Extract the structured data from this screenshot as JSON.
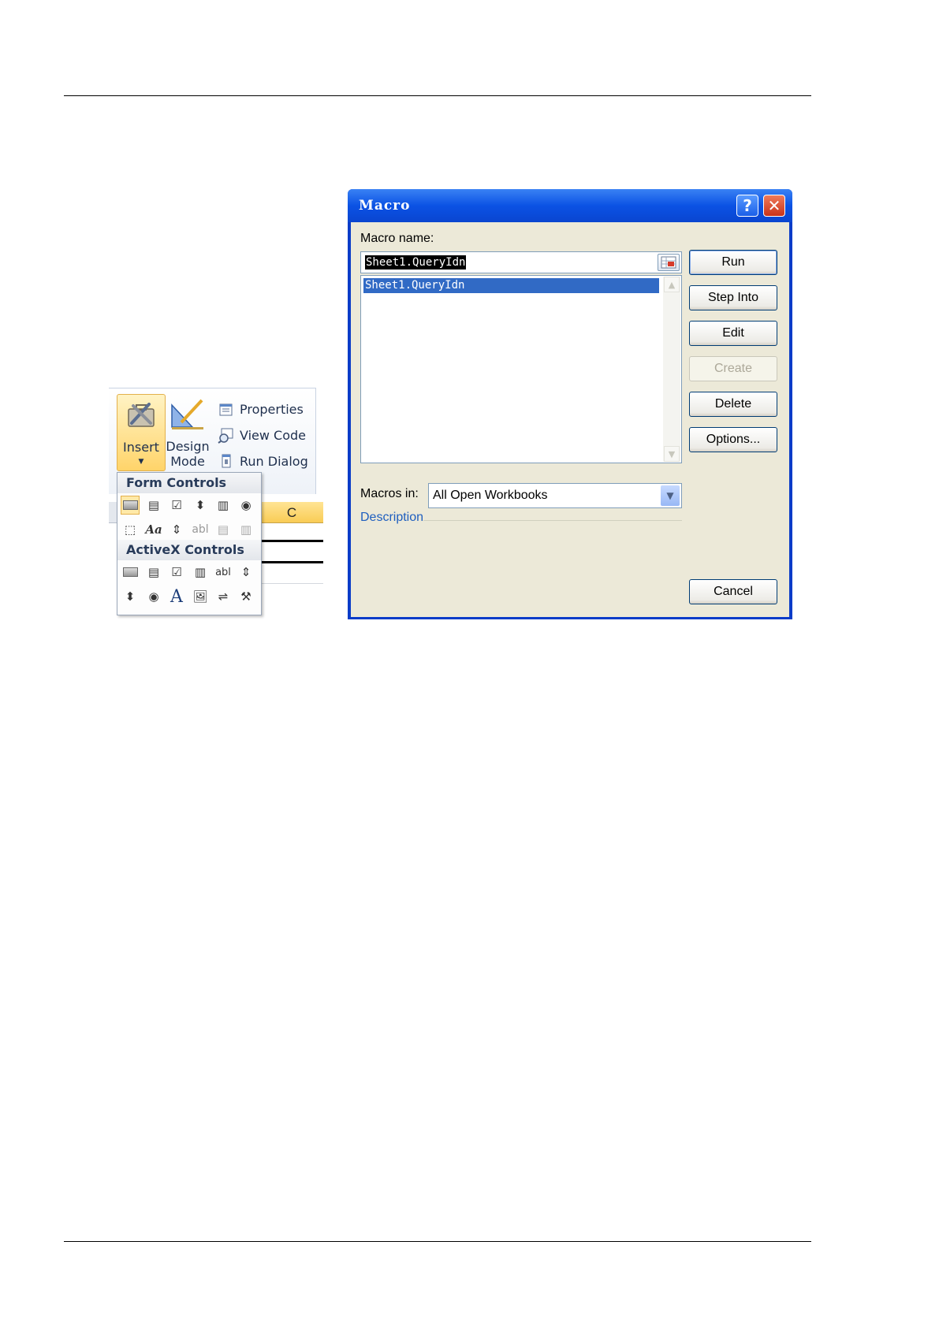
{
  "ribbon": {
    "insert_label": "Insert",
    "design_label_1": "Design",
    "design_label_2": "Mode",
    "properties": "Properties",
    "view_code": "View Code",
    "run_dialog": "Run Dialog",
    "form_controls_heading": "Form Controls",
    "activex_controls_heading": "ActiveX Controls",
    "column_header": "C"
  },
  "dialog": {
    "title": "Macro",
    "help_glyph": "?",
    "close_glyph": "✕",
    "macro_name_label": "Macro name:",
    "macro_name_value": "Sheet1.QueryIdn",
    "macros": [
      "Sheet1.QueryIdn"
    ],
    "macros_in_label": "Macros in:",
    "macros_in_value": "All Open Workbooks",
    "description_label": "Description",
    "buttons": {
      "run": "Run",
      "step_into": "Step Into",
      "edit": "Edit",
      "create": "Create",
      "delete": "Delete",
      "options": "Options...",
      "cancel": "Cancel"
    },
    "colors": {
      "title_blue": "#0b52e4",
      "selection": "#316ac5",
      "client": "#ece9d8",
      "description_text": "#1f5fbf"
    }
  }
}
